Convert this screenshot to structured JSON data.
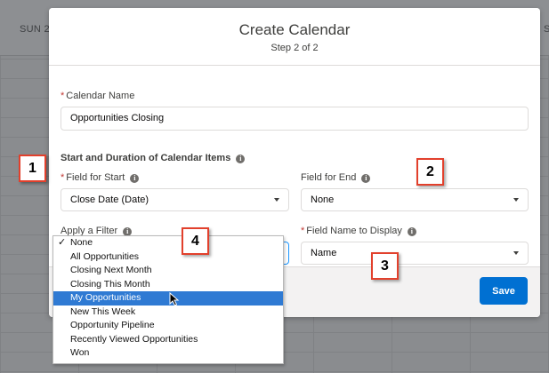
{
  "backdrop": {
    "day_left": "SUN 2"
  },
  "modal": {
    "title": "Create Calendar",
    "subtitle": "Step 2 of 2",
    "calendar_name": {
      "label": "Calendar Name",
      "value": "Opportunities Closing"
    },
    "section_title": "Start and Duration of Calendar Items",
    "field_for_start": {
      "label": "Field for Start",
      "value": "Close Date (Date)"
    },
    "field_for_end": {
      "label": "Field for End",
      "value": "None"
    },
    "apply_filter": {
      "label": "Apply a Filter"
    },
    "field_name_display": {
      "label": "Field Name to Display",
      "value": "Name"
    },
    "save_label": "Save"
  },
  "dropdown": {
    "checked_item": "None",
    "highlighted_item": "My Opportunities",
    "options": [
      "None",
      "All Opportunities",
      "Closing Next Month",
      "Closing This Month",
      "My Opportunities",
      "New This Week",
      "Opportunity Pipeline",
      "Recently Viewed Opportunities",
      "Won"
    ]
  },
  "callouts": [
    "1",
    "2",
    "3",
    "4"
  ],
  "icons": {
    "required": "*",
    "info": "info-icon",
    "caret": "chevron-down-icon",
    "check": "✓"
  },
  "colors": {
    "primary_button": "#0070d2",
    "highlight": "#2f7ad3",
    "callout_border": "#e2402c",
    "required": "#c23934"
  }
}
